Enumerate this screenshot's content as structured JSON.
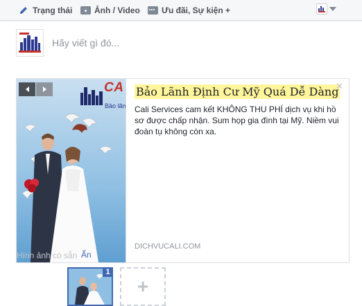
{
  "composer_tabs": [
    {
      "label": "Trạng thái",
      "icon": "pencil-icon"
    },
    {
      "label": "Ảnh / Video",
      "icon": "camera-icon"
    },
    {
      "label": "Ưu đãi, Sự kiện +",
      "icon": "more-icon"
    }
  ],
  "composer": {
    "placeholder": "Hãy viết gì đó..."
  },
  "ad": {
    "title": "Bảo Lãnh Định Cư Mỹ Quá Dễ Dàng",
    "description": "Cali Services cam kết KHÔNG THU PHÍ dịch vụ khi hồ sơ được chấp nhận. Sum họp gia đình tại Mỹ. Niềm vui đoàn tụ không còn xa.",
    "domain": "DICHVUCALI.COM",
    "media_logo": "CA",
    "media_logo_sub": "Bảo lãn"
  },
  "available_images": {
    "label": "Hình ảnh có sẵn",
    "hide_label": "Ẩn",
    "count": "1"
  },
  "colors": {
    "accent": "#4267b2",
    "highlight": "#fff59a",
    "logo_red": "#c4302b"
  }
}
